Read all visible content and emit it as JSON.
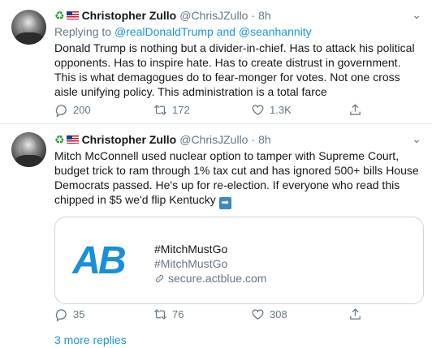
{
  "tweets": [
    {
      "name": "Christopher Zullo",
      "handle": "@ChrisJZullo",
      "dot": "·",
      "time": "8h",
      "badges": [
        "recycle-icon",
        "us-flag-icon"
      ],
      "reply_prefix": "Replying to",
      "reply_to": "@realDonaldTrump and @seanhannity",
      "text": "Donald Trump is nothing but a divider-in-chief. Has to attack his political opponents. Has to inspire hate. Has to create distrust in government. This is what demagogues do to fear-monger for votes. Not one cross aisle unifying policy. This administration is a total farce",
      "replies": "200",
      "retweets": "172",
      "likes": "1.3K"
    },
    {
      "name": "Christopher Zullo",
      "handle": "@ChrisJZullo",
      "dot": "·",
      "time": "8h",
      "badges": [
        "recycle-icon",
        "us-flag-icon"
      ],
      "text": "Mitch McConnell used nuclear option to tamper with Supreme Court, budget trick to ram through 1% tax cut and has ignored 500+ bills House Democrats passed. He's up for re-election. If everyone who read this chipped in $5 we'd flip Kentucky",
      "text_emoji": "➡",
      "card": {
        "logo": "AB",
        "title": "#MitchMustGo",
        "description": "#MitchMustGo",
        "domain": "secure.actblue.com"
      },
      "replies": "35",
      "retweets": "76",
      "likes": "308"
    }
  ],
  "more_replies": "3 more replies",
  "colors": {
    "accent": "#1b95e0",
    "secondary_text": "#657786",
    "border": "#e6ecf0",
    "logo": "#1a8fd8"
  }
}
